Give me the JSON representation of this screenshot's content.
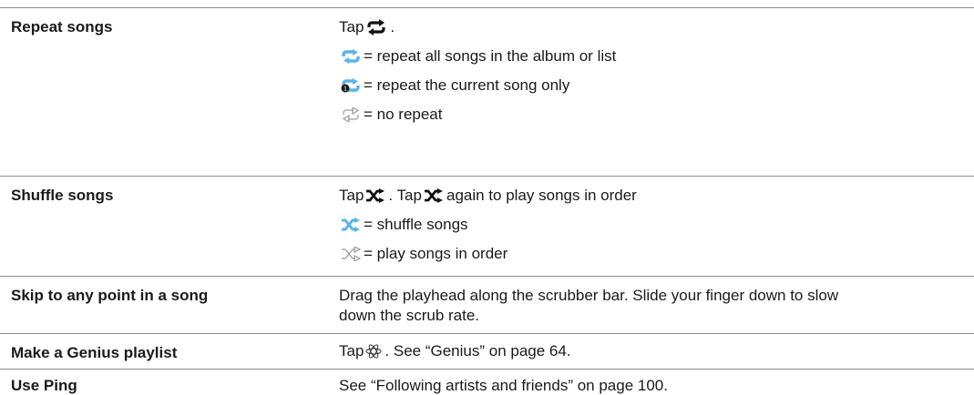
{
  "colors": {
    "rule": "#8c8c8c",
    "text": "#1a1a1a",
    "blue_icon": "#5ab4e8",
    "gray_icon": "#9a9a9a"
  },
  "rows": [
    {
      "action": "Repeat songs",
      "lines": [
        {
          "before": "Tap ",
          "icon": "repeat-icon",
          "after": "."
        },
        {
          "icon": "repeat-all-blue-icon",
          "after": " = repeat all songs in the album or list"
        },
        {
          "icon": "repeat-one-blue-icon",
          "after": " = repeat the current song only"
        },
        {
          "icon": "repeat-off-outline-icon",
          "after": " = no repeat"
        }
      ]
    },
    {
      "action": "Shuffle songs",
      "lines": [
        {
          "before": "Tap ",
          "icon": "shuffle-icon",
          "middle": ". Tap ",
          "icon2": "shuffle-icon",
          "after": " again to play songs in order"
        },
        {
          "icon": "shuffle-on-blue-icon",
          "after": " = shuffle songs"
        },
        {
          "icon": "shuffle-off-outline-icon",
          "after": " = play songs in order"
        }
      ]
    },
    {
      "action": "Skip to any point in a song",
      "lines": [
        {
          "after": "Drag the playhead along the scrubber bar. Slide your finger down to slow"
        },
        {
          "after": "down the scrub rate."
        }
      ]
    },
    {
      "action": "Make a Genius playlist",
      "lines": [
        {
          "before": "Tap ",
          "icon": "genius-icon",
          "after": ". See “Genius” on page 64."
        }
      ]
    },
    {
      "action": "Use Ping",
      "lines": [
        {
          "after": "See “Following artists and friends” on page 100."
        }
      ]
    }
  ]
}
